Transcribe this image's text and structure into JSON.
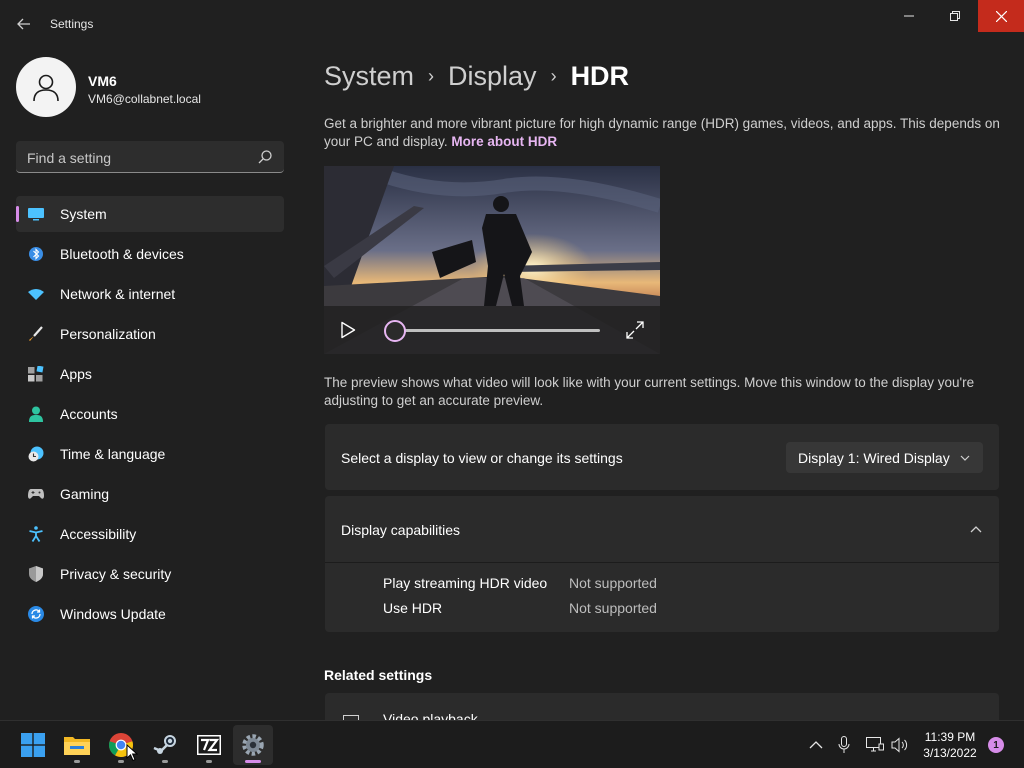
{
  "window": {
    "title": "Settings",
    "back_icon": "back-arrow-icon",
    "minimize_icon": "minimize-icon",
    "restore_icon": "restore-icon",
    "close_icon": "close-icon",
    "close_hover_color": "#c42b1c"
  },
  "user": {
    "name": "VM6",
    "email": "VM6@collabnet.local",
    "avatar_icon": "person-icon"
  },
  "search": {
    "placeholder": "Find a setting",
    "icon": "search-icon"
  },
  "sidebar": {
    "accent_color": "#d68ce8",
    "items": [
      {
        "label": "System",
        "icon": "system-icon",
        "selected": true
      },
      {
        "label": "Bluetooth & devices",
        "icon": "bluetooth-icon",
        "selected": false
      },
      {
        "label": "Network & internet",
        "icon": "wifi-icon",
        "selected": false
      },
      {
        "label": "Personalization",
        "icon": "brush-icon",
        "selected": false
      },
      {
        "label": "Apps",
        "icon": "apps-icon",
        "selected": false
      },
      {
        "label": "Accounts",
        "icon": "accounts-icon",
        "selected": false
      },
      {
        "label": "Time & language",
        "icon": "clock-globe-icon",
        "selected": false
      },
      {
        "label": "Gaming",
        "icon": "gamepad-icon",
        "selected": false
      },
      {
        "label": "Accessibility",
        "icon": "accessibility-icon",
        "selected": false
      },
      {
        "label": "Privacy & security",
        "icon": "shield-icon",
        "selected": false
      },
      {
        "label": "Windows Update",
        "icon": "update-icon",
        "selected": false
      }
    ]
  },
  "breadcrumb": {
    "items": [
      "System",
      "Display"
    ],
    "current": "HDR",
    "separator": "›"
  },
  "hdr": {
    "description": "Get a brighter and more vibrant picture for high dynamic range (HDR) games, videos, and apps. This depends on your PC and display.",
    "more_link": "More about HDR",
    "preview_note": "The preview shows what video will look like with your current settings. Move this window to the display you're adjusting to get an accurate preview.",
    "video": {
      "play_icon": "play-icon",
      "fullscreen_icon": "fullscreen-icon",
      "progress": 0
    }
  },
  "display_select": {
    "label": "Select a display to view or change its settings",
    "value": "Display 1: Wired Display",
    "chevron_icon": "chevron-down-icon"
  },
  "capabilities": {
    "title": "Display capabilities",
    "expanded": true,
    "chevron_icon": "chevron-up-icon",
    "rows": [
      {
        "name": "Play streaming HDR video",
        "value": "Not supported"
      },
      {
        "name": "Use HDR",
        "value": "Not supported"
      }
    ]
  },
  "related": {
    "heading": "Related settings",
    "items": [
      {
        "label": "Video playback",
        "icon": "video-playback-icon"
      }
    ]
  },
  "taskbar": {
    "apps": [
      {
        "name": "Start",
        "icon": "windows-start-icon",
        "running": false
      },
      {
        "name": "File Explorer",
        "icon": "file-explorer-icon",
        "running": true
      },
      {
        "name": "Google Chrome",
        "icon": "chrome-icon",
        "running": true
      },
      {
        "name": "Steam",
        "icon": "steam-icon",
        "running": true
      },
      {
        "name": "7-Zip",
        "icon": "7zip-icon",
        "running": true
      },
      {
        "name": "Settings",
        "icon": "settings-gear-icon",
        "running": true,
        "active": true
      }
    ],
    "tray": [
      "chevron-up-icon",
      "microphone-icon",
      "network-icon",
      "volume-icon"
    ],
    "time": "11:39 PM",
    "date": "3/13/2022",
    "notification_count": "1"
  }
}
